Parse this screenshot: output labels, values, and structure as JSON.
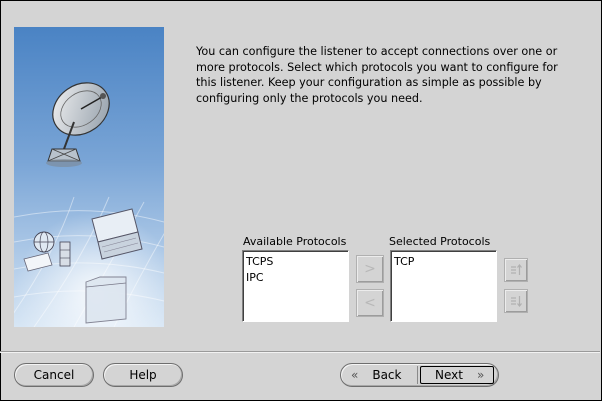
{
  "description": "You can configure the listener to accept connections over one or more protocols. Select which protocols you want to configure for this listener. Keep your configuration as simple as possible by configuring only the protocols you need.",
  "available": {
    "label": "Available Protocols",
    "items": [
      "TCPS",
      "IPC"
    ]
  },
  "selected": {
    "label": "Selected Protocols",
    "items": [
      "TCP"
    ]
  },
  "icons": {
    "move_right": "chevron-right-icon",
    "move_left": "chevron-left-icon",
    "move_up": "move-up-icon",
    "move_down": "move-down-icon"
  },
  "buttons": {
    "cancel": "Cancel",
    "help": "Help",
    "back_mnemonic": "B",
    "back_rest": "ack",
    "next_mnemonic": "N",
    "next_rest": "ext"
  },
  "colors": {
    "background": "#d4d4d4",
    "image_sky_top": "#4a83c4",
    "image_sky_bottom": "#cfe0f2"
  }
}
